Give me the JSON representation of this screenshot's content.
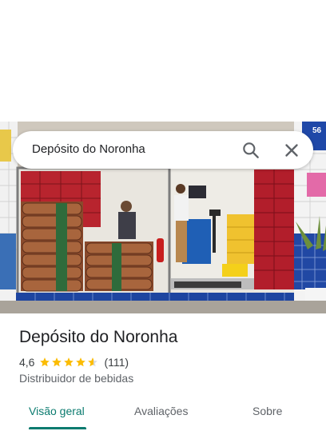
{
  "search": {
    "query": "Depósito do Noronha"
  },
  "place": {
    "title": "Depósito do Noronha",
    "rating": "4,6",
    "stars": 4.6,
    "review_count": "(111)",
    "category": "Distribuidor de bebidas"
  },
  "tabs": [
    {
      "label": "Visão geral",
      "active": true
    },
    {
      "label": "Avaliações",
      "active": false
    },
    {
      "label": "Sobre",
      "active": false
    }
  ],
  "colors": {
    "accent": "#0b7b6f",
    "star": "#fbbc04"
  },
  "photo": {
    "sign_fragment": "56"
  }
}
